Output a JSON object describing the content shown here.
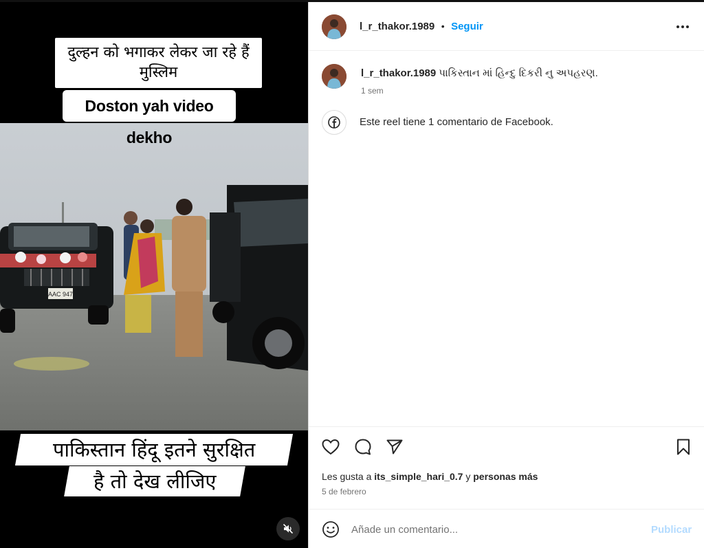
{
  "video": {
    "caption_top_line1": "दुल्हन को भगाकर लेकर जा रहे हैं",
    "caption_top_line2": "मुस्लिम",
    "caption_english": "Doston yah video dekho",
    "caption_bottom_line1": "पाकिस्तान हिंदू इतने सुरक्षित",
    "caption_bottom_line2": "है तो देख लीजिए",
    "number_plate": "AAC 947"
  },
  "header": {
    "username": "l_r_thakor.1989",
    "separator": "•",
    "follow_label": "Seguir"
  },
  "caption": {
    "username": "l_r_thakor.1989",
    "text": "પાકિસ્તાન માં હિન્દુ દિકરી નુ અપહરણ.",
    "time": "1 sem"
  },
  "facebook_note": {
    "text": "Este reel tiene 1 comentario de Facebook."
  },
  "likes": {
    "prefix": "Les gusta a ",
    "user": "its_simple_hari_0.7",
    "mid": " y ",
    "others": "personas más"
  },
  "date": "5 de febrero",
  "comment_box": {
    "placeholder": "Añade un comentario...",
    "publish_label": "Publicar"
  },
  "icons": {
    "more": "more-horizontal-icon",
    "like": "heart-icon",
    "comment": "comment-icon",
    "share": "paper-plane-icon",
    "save": "bookmark-icon",
    "emoji": "emoji-icon",
    "facebook": "facebook-icon",
    "mute": "speaker-muted-icon"
  },
  "colors": {
    "accent": "#0095f6",
    "publish_disabled": "#b3dbff",
    "muted_text": "#737373"
  }
}
